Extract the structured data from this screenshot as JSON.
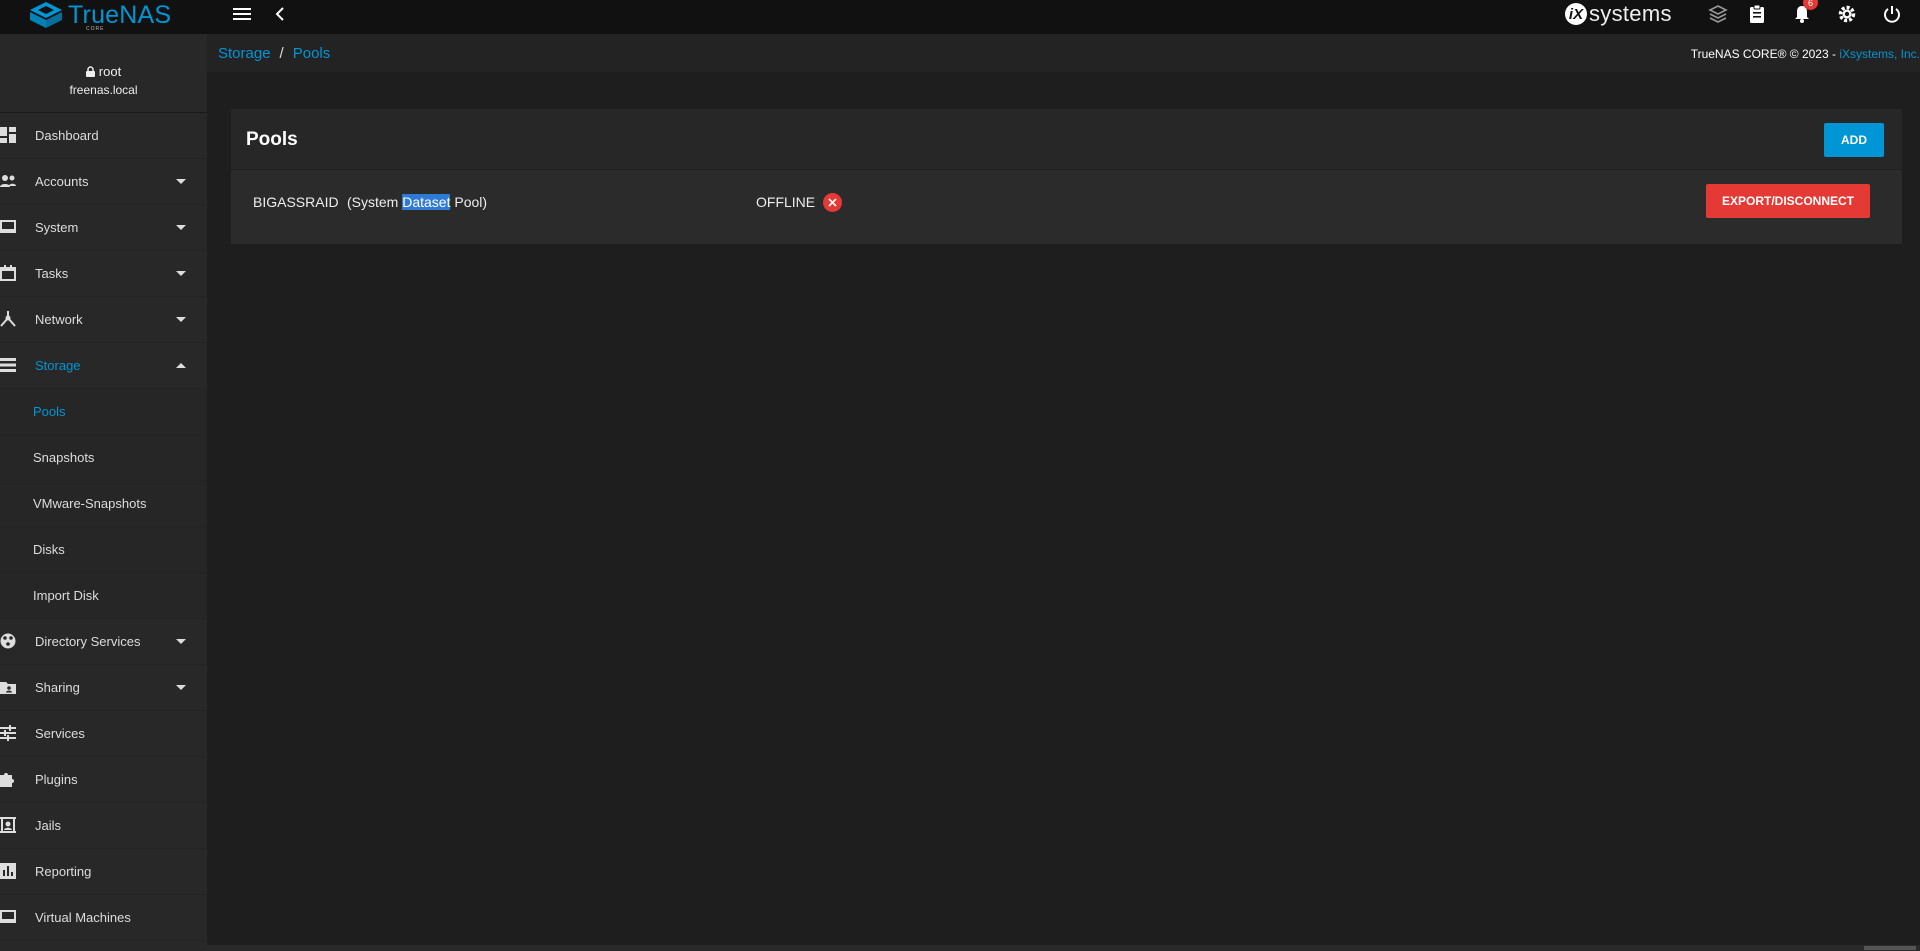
{
  "topbar": {
    "brand_name": "TrueNAS",
    "brand_sub": "CORE",
    "vendor_logo_text": "systems",
    "vendor_logo_mark": "iX",
    "notification_count": "6",
    "icons": [
      "menu-icon",
      "back-icon",
      "truecommand-icon",
      "task-manager-icon",
      "bell-icon",
      "gear-icon",
      "power-icon"
    ]
  },
  "user": {
    "name": "root",
    "host": "freenas.local"
  },
  "sidebar": {
    "items": [
      {
        "label": "Dashboard",
        "icon": "dashboard-icon",
        "expandable": false
      },
      {
        "label": "Accounts",
        "icon": "accounts-icon",
        "expandable": true
      },
      {
        "label": "System",
        "icon": "laptop-icon",
        "expandable": true
      },
      {
        "label": "Tasks",
        "icon": "calendar-icon",
        "expandable": true
      },
      {
        "label": "Network",
        "icon": "network-icon",
        "expandable": true
      },
      {
        "label": "Storage",
        "icon": "storage-icon",
        "expandable": true,
        "expanded": true,
        "active": true
      },
      {
        "label": "Directory Services",
        "icon": "directory-icon",
        "expandable": true
      },
      {
        "label": "Sharing",
        "icon": "sharing-icon",
        "expandable": true
      },
      {
        "label": "Services",
        "icon": "tune-icon",
        "expandable": false
      },
      {
        "label": "Plugins",
        "icon": "puzzle-icon",
        "expandable": false
      },
      {
        "label": "Jails",
        "icon": "jail-icon",
        "expandable": false
      },
      {
        "label": "Reporting",
        "icon": "chart-icon",
        "expandable": false
      },
      {
        "label": "Virtual Machines",
        "icon": "laptop-icon",
        "expandable": false
      }
    ],
    "storage_subitems": [
      {
        "label": "Pools",
        "active": true
      },
      {
        "label": "Snapshots"
      },
      {
        "label": "VMware-Snapshots"
      },
      {
        "label": "Disks"
      },
      {
        "label": "Import Disk"
      }
    ]
  },
  "breadcrumb": {
    "parent": "Storage",
    "separator": "/",
    "current": "Pools"
  },
  "footer": {
    "copyright": "TrueNAS CORE® © 2023 - ",
    "company": "iXsystems, Inc."
  },
  "pools_card": {
    "title": "Pools",
    "add_label": "ADD",
    "pool": {
      "name": "BIGASSRAID",
      "desc_prefix": "(System ",
      "desc_highlight": "Dataset",
      "desc_suffix": " Pool)",
      "status": "OFFLINE",
      "export_label": "EXPORT/DISCONNECT"
    }
  },
  "colors": {
    "accent": "#0095d5",
    "danger": "#e53935",
    "background": "#1e1e1e",
    "sidebar": "#282828",
    "topbar": "#111111"
  }
}
